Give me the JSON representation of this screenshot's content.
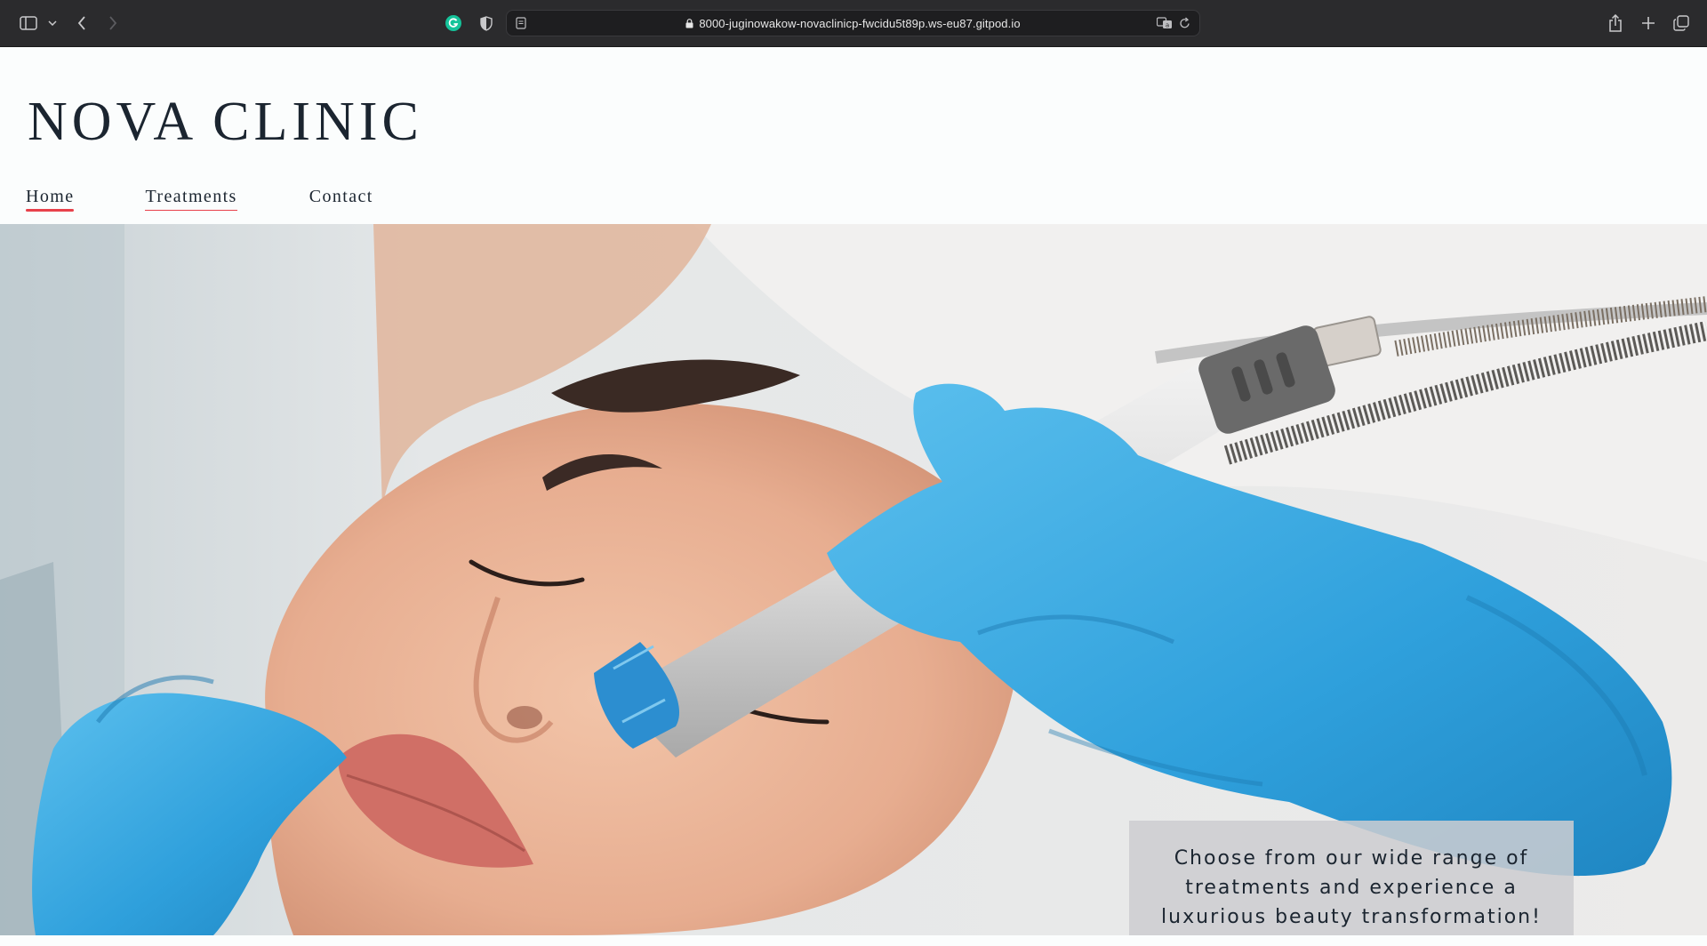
{
  "browser": {
    "url": "8000-juginowakow-novaclinicp-fwcidu5t89p.ws-eu87.gitpod.io"
  },
  "site": {
    "logo": "NOVA CLINIC",
    "nav": [
      {
        "label": "Home",
        "state": "active"
      },
      {
        "label": "Treatments",
        "state": "underlined"
      },
      {
        "label": "Contact",
        "state": "default"
      }
    ],
    "hero": {
      "caption": "Choose from our wide range of treatments and experience a luxurious beauty transformation!"
    }
  },
  "colors": {
    "accent": "#e8414b",
    "text": "#1b2530",
    "glove": "#3aa9e0"
  },
  "icons": [
    "sidebar-icon",
    "chevron-down-icon",
    "back-icon",
    "forward-icon",
    "grammarly-icon",
    "shield-icon",
    "reader-icon",
    "lock-icon",
    "translate-icon",
    "reload-icon",
    "share-icon",
    "new-tab-icon",
    "tabs-overview-icon"
  ]
}
